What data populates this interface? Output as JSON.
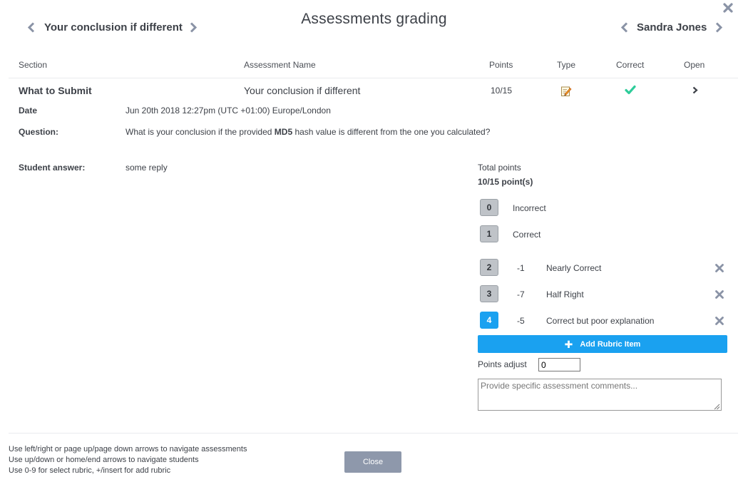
{
  "header": {
    "title": "Assessments grading",
    "assessment_nav_label": "Your conclusion if different",
    "student_nav_label": "Sandra Jones"
  },
  "table": {
    "columns": [
      "Section",
      "Assessment Name",
      "Points",
      "Type",
      "Correct",
      "Open"
    ],
    "row": {
      "section": "What to Submit",
      "assessment_name": "Your conclusion if different",
      "points": "10/15",
      "type_icon": "edit-note-icon",
      "correct_icon": "checkmark-icon",
      "open_icon": "chevron-right-icon"
    }
  },
  "details": {
    "date_label": "Date",
    "date_value": "Jun 20th 2018 12:27pm (UTC +01:00) Europe/London",
    "question_label": "Question:",
    "question_before": "What is your conclusion if the provided ",
    "question_bold": "MD5",
    "question_after": " hash value is different from the one you calculated?",
    "answer_label": "Student answer:",
    "answer_value": "some reply"
  },
  "grading": {
    "total_label": "Total points",
    "total_value": "10/15 point(s)",
    "rubric_items": [
      {
        "key": "0",
        "points": "",
        "label": "Incorrect",
        "removable": false,
        "selected": false
      },
      {
        "key": "1",
        "points": "",
        "label": "Correct",
        "removable": false,
        "selected": false
      },
      {
        "key": "2",
        "points": "-1",
        "label": "Nearly Correct",
        "removable": true,
        "selected": false
      },
      {
        "key": "3",
        "points": "-7",
        "label": "Half Right",
        "removable": true,
        "selected": false
      },
      {
        "key": "4",
        "points": "-5",
        "label": "Correct but poor explanation",
        "removable": true,
        "selected": true
      }
    ],
    "add_rubric_label": "Add Rubric Item",
    "points_adjust_label": "Points adjust",
    "points_adjust_value": "0",
    "comment_placeholder": "Provide specific assessment comments..."
  },
  "footer": {
    "help_lines": [
      "Use left/right or page up/page down arrows to navigate assessments",
      "Use up/down or home/end arrows to navigate students",
      "Use 0-9 for select rubric, +/insert for add rubric"
    ],
    "close_label": "Close"
  },
  "colors": {
    "accent": "#1aa1f0",
    "check": "#2ecc9a",
    "close_button": "#8e98ab",
    "nav_arrow": "#8a93a6"
  }
}
